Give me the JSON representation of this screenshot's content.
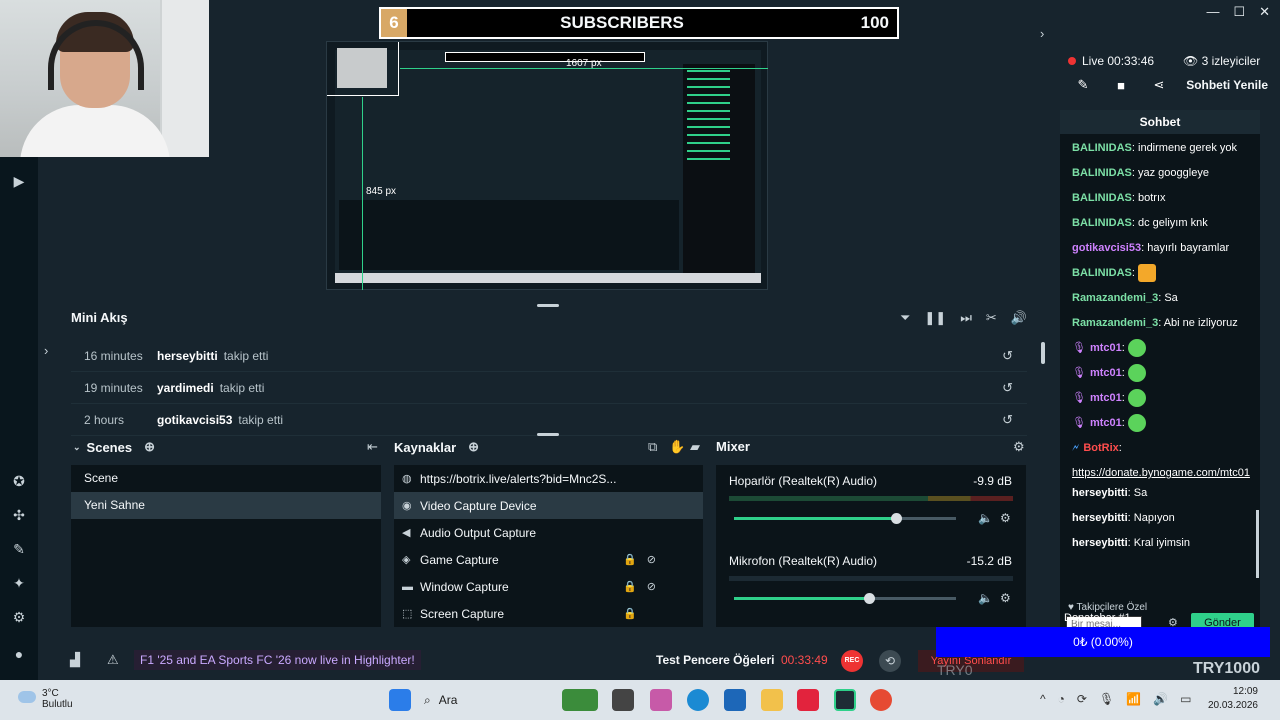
{
  "overlay": {
    "subscriber_count": "6",
    "subscriber_title": "SUBSCRIBERS",
    "subscriber_goal": "100",
    "px_width": "1607  px",
    "px_height": "845  px"
  },
  "mini_feed": {
    "title": "Mini Akış",
    "rows": [
      {
        "time": "16 minutes",
        "user": "herseybitti",
        "action": "takip etti"
      },
      {
        "time": "19 minutes",
        "user": "yardimedi",
        "action": "takip etti"
      },
      {
        "time": "2 hours",
        "user": "gotikavcisi53",
        "action": "takip etti"
      }
    ]
  },
  "scenes": {
    "title": "Scenes",
    "items": [
      "Scene",
      "Yeni Sahne"
    ]
  },
  "sources": {
    "title": "Kaynaklar",
    "items": [
      {
        "label": "https://botrix.live/alerts?bid=Mnc2S...",
        "icon": "globe-icon"
      },
      {
        "label": "Video Capture Device",
        "icon": "camera-icon"
      },
      {
        "label": "Audio Output Capture",
        "icon": "speaker-icon"
      },
      {
        "label": "Game Capture",
        "icon": "gamepad-icon"
      },
      {
        "label": "Window Capture",
        "icon": "window-icon"
      },
      {
        "label": "Screen Capture",
        "icon": "screen-icon"
      }
    ]
  },
  "mixer": {
    "title": "Mixer",
    "channels": [
      {
        "name": "Hoparlör (Realtek(R) Audio)",
        "db": "-9.9 dB",
        "level": 0.73
      },
      {
        "name": "Mikrofon (Realtek(R) Audio)",
        "db": "-15.2 dB",
        "level": 0.61
      }
    ]
  },
  "footer": {
    "news": "F1 '25 and EA Sports FC '26 now live in Highlighter!",
    "test_label": "Test Pencere Öğeleri",
    "rec_time": "00:33:49",
    "rec_label": "REC",
    "stop_label": "Yayını Sonlandır"
  },
  "chat": {
    "live_label": "Live 00:33:46",
    "viewers": "3 izleyiciler",
    "refresh_label": "Sohbeti Yenile",
    "title": "Sohbet",
    "messages": [
      {
        "user": "BALINIDAS",
        "text": ": indirmene gerek yok",
        "color": "n"
      },
      {
        "user": "BALINIDAS",
        "text": ": yaz googgleye",
        "color": "n"
      },
      {
        "user": "BALINIDAS",
        "text": ": botrıx",
        "color": "n"
      },
      {
        "user": "BALINIDAS",
        "text": ": dc geliyım knk",
        "color": "n"
      },
      {
        "user": "gotikavcisi53",
        "text": ": hayırlı bayramlar",
        "color": "p"
      },
      {
        "user": "BALINIDAS",
        "text": ":",
        "color": "n",
        "emote": "gold"
      },
      {
        "user": "Ramazandemi_3",
        "text": ": Sa",
        "color": "n"
      },
      {
        "user": "Ramazandemi_3",
        "text": ": Abi ne izliyoruz",
        "color": "n"
      },
      {
        "user": "mtc01",
        "text": ":",
        "color": "p",
        "emote": "green",
        "mic": true
      },
      {
        "user": "mtc01",
        "text": ":",
        "color": "p",
        "emote": "green",
        "mic": true
      },
      {
        "user": "mtc01",
        "text": ":",
        "color": "p",
        "emote": "green",
        "mic": true
      },
      {
        "user": "mtc01",
        "text": ":",
        "color": "p",
        "emote": "green",
        "mic": true
      },
      {
        "user": "BotRix",
        "text": ":",
        "color": "b"
      }
    ],
    "link": "https://donate.bynogame.com/mtc01",
    "tail": [
      {
        "user": "herseybitti",
        "text": ": Sa"
      },
      {
        "user": "herseybitti",
        "text": ": Napıyon"
      },
      {
        "user": "herseybitti",
        "text": ": Kral iyimsin"
      }
    ],
    "followers_only": "Takipçilere Özel",
    "input_placeholder": "Bir mesaj...",
    "send_label": "Gönder"
  },
  "donation": {
    "label": "Donatebar #1",
    "progress": "0₺ (0.00%)",
    "level": 0,
    "watermark": "TRY1000",
    "watermark_faint": "TRY0"
  },
  "taskbar": {
    "temp": "3°C",
    "weather": "Bulutlu",
    "search": "Ara",
    "time": "12:09",
    "date": "20.03.2026"
  },
  "colors": {
    "accent": "#2fd08a",
    "background": "#17242d",
    "rec_red": "#e33333",
    "donation_blue": "#0000ff"
  }
}
